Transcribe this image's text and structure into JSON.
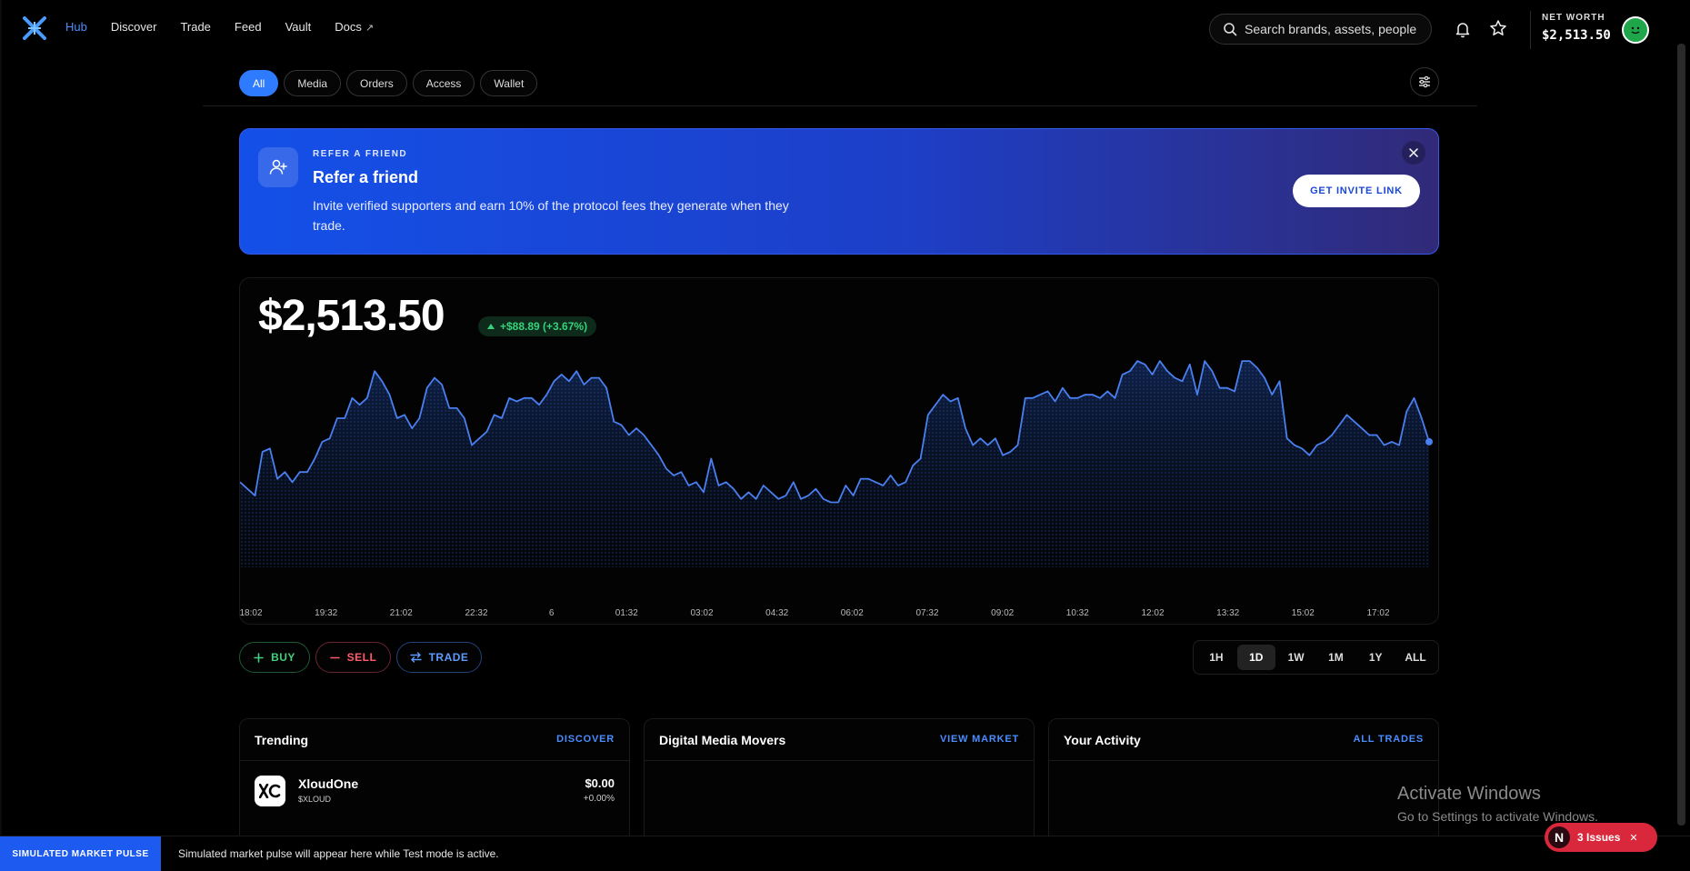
{
  "nav": {
    "links": [
      {
        "label": "Hub",
        "active": true
      },
      {
        "label": "Discover",
        "active": false
      },
      {
        "label": "Trade",
        "active": false
      },
      {
        "label": "Feed",
        "active": false
      },
      {
        "label": "Vault",
        "active": false
      },
      {
        "label": "Docs",
        "active": false,
        "external": true
      }
    ],
    "external_glyph": "↗",
    "search_placeholder": "Search brands, assets, people",
    "net_worth_label": "NET WORTH",
    "net_worth_value": "$2,513.50"
  },
  "tabs": [
    "All",
    "Media",
    "Orders",
    "Access",
    "Wallet"
  ],
  "active_tab": "All",
  "banner": {
    "eyebrow": "REFER A FRIEND",
    "title": "Refer a friend",
    "description": "Invite verified supporters and earn 10% of the protocol fees they generate when they trade.",
    "cta": "GET INVITE LINK"
  },
  "portfolio": {
    "value": "$2,513.50",
    "change": "+$88.89 (+3.67%)",
    "change_color": "#36d27a"
  },
  "chart_data": {
    "type": "area",
    "color": "#4a7ff0",
    "x_labels": [
      "18:02",
      "19:32",
      "21:02",
      "22:32",
      "6",
      "01:32",
      "03:02",
      "04:32",
      "06:02",
      "07:32",
      "09:02",
      "10:32",
      "12:02",
      "13:32",
      "15:02",
      "17:02"
    ],
    "values": [
      61,
      59,
      57,
      70,
      71,
      62,
      64,
      61,
      64,
      64,
      68,
      73,
      74,
      80,
      80,
      86,
      84,
      86,
      94,
      91,
      87,
      80,
      81,
      77,
      80,
      89,
      92,
      90,
      83,
      83,
      80,
      72,
      74,
      76,
      81,
      80,
      86,
      85,
      86,
      86,
      84,
      87,
      91,
      93,
      91,
      94,
      90,
      92,
      92,
      89,
      79,
      78,
      75,
      77,
      75,
      72,
      69,
      65,
      63,
      64,
      60,
      61,
      58,
      68,
      60,
      61,
      59,
      56,
      58,
      56,
      60,
      58,
      56,
      57,
      61,
      56,
      57,
      59,
      56,
      55,
      55,
      60,
      57,
      62,
      62,
      61,
      60,
      63,
      60,
      61,
      66,
      68,
      81,
      84,
      87,
      85,
      86,
      77,
      72,
      74,
      72,
      74,
      69,
      70,
      72,
      86,
      86,
      87,
      88,
      85,
      89,
      86,
      86,
      87,
      87,
      86,
      88,
      86,
      93,
      94,
      97,
      96,
      93,
      97,
      94,
      92,
      91,
      96,
      87,
      97,
      94,
      89,
      89,
      88,
      97,
      97,
      95,
      92,
      87,
      91,
      74,
      72,
      71,
      69,
      72,
      73,
      75,
      78,
      81,
      79,
      77,
      75,
      75,
      72,
      73,
      72,
      82,
      86,
      80,
      73
    ],
    "ylim": [
      50,
      100
    ]
  },
  "actions": {
    "buy": "BUY",
    "sell": "SELL",
    "trade": "TRADE"
  },
  "ranges": [
    "1H",
    "1D",
    "1W",
    "1M",
    "1Y",
    "ALL"
  ],
  "active_range": "1D",
  "panels": {
    "trending": {
      "title": "Trending",
      "link": "DISCOVER",
      "items": [
        {
          "name": "XloudOne",
          "ticker": "$XLOUD",
          "price": "$0.00",
          "change": "+0.00%"
        }
      ]
    },
    "movers": {
      "title": "Digital Media Movers",
      "link": "VIEW MARKET"
    },
    "activity": {
      "title": "Your Activity",
      "link": "ALL TRADES"
    }
  },
  "ticker": {
    "label": "SIMULATED MARKET PULSE",
    "text": "Simulated market pulse will appear here while Test mode is active."
  },
  "windows": {
    "line1": "Activate Windows",
    "line2": "Go to Settings to activate Windows."
  },
  "issues": {
    "badge": "N",
    "label": "3 Issues",
    "close": "✕"
  }
}
